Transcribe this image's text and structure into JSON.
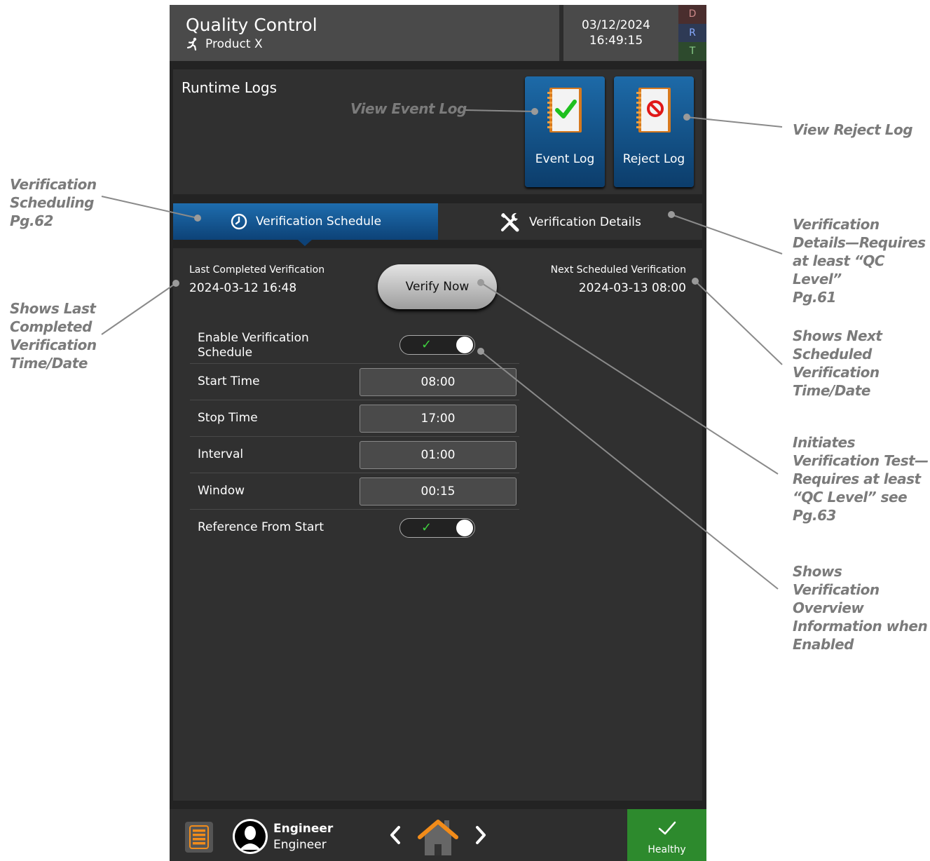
{
  "header": {
    "title": "Quality Control",
    "product": "Product X",
    "date": "03/12/2024",
    "time": "16:49:15",
    "drt": [
      "D",
      "R",
      "T"
    ]
  },
  "runtime_logs": {
    "title": "Runtime Logs",
    "event_log_label": "Event Log",
    "reject_log_label": "Reject Log"
  },
  "tabs": [
    {
      "label": "Verification Schedule",
      "selected": true
    },
    {
      "label": "Verification Details",
      "selected": false
    }
  ],
  "schedule": {
    "last_label": "Last Completed Verification",
    "last_value": "2024-03-12 16:48",
    "next_label": "Next Scheduled Verification",
    "next_value": "2024-03-13 08:00",
    "verify_now": "Verify Now",
    "enable_label": "Enable Verification Schedule",
    "enable_on": true,
    "start_label": "Start Time",
    "start_value": "08:00",
    "stop_label": "Stop Time",
    "stop_value": "17:00",
    "interval_label": "Interval",
    "interval_value": "01:00",
    "window_label": "Window",
    "window_value": "00:15",
    "reference_label": "Reference From Start",
    "reference_on": true
  },
  "footer": {
    "user_name": "Engineer",
    "user_role": "Engineer",
    "status": "Healthy"
  },
  "colors": {
    "accent_blue": "#1d6aa8",
    "healthy_green": "#2d8a2d",
    "check_green": "#3fcf3f",
    "annotation_gray": "#7b7b7b"
  },
  "annotations": {
    "view_event_log": "View Event Log",
    "view_reject_log": "View Reject Log",
    "verification_scheduling": [
      "Verification",
      "Scheduling",
      "Pg.62"
    ],
    "verification_details": [
      "Verification",
      "Details—Requires",
      "at least “QC Level”",
      "Pg.61"
    ],
    "shows_last": [
      "Shows Last",
      "Completed",
      "Verification",
      "Time/Date"
    ],
    "shows_next": [
      "Shows Next",
      "Scheduled",
      "Verification",
      "Time/Date"
    ],
    "initiates": [
      "Initiates",
      "Verification Test—",
      "Requires at least",
      "“QC Level” see",
      "Pg.63"
    ],
    "overview": [
      "Shows Verification",
      "Overview",
      "Information when",
      "Enabled"
    ]
  }
}
